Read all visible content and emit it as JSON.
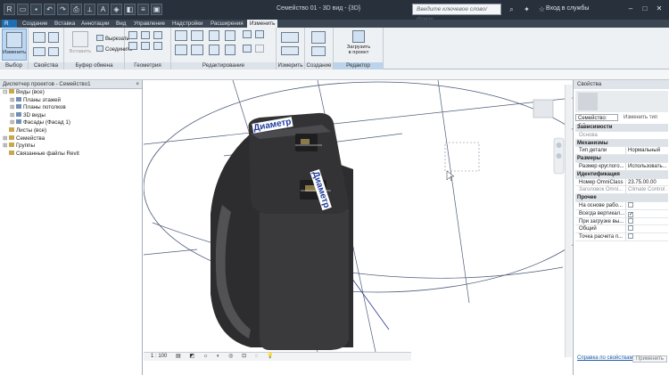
{
  "titlebar": {
    "title": "Семейство 01 - 3D вид - {3D}",
    "search_placeholder": "Введите ключевое слово/фразу",
    "login": "Вход в службы"
  },
  "tabs": [
    "Создание",
    "Вставка",
    "Аннотации",
    "Вид",
    "Управление",
    "Надстройки",
    "Расширения",
    "Изменить"
  ],
  "ribbon": {
    "groups": {
      "select": "Выбор",
      "properties": "Свойства",
      "clipboard": "Буфер обмена",
      "geometry": "Геометрия",
      "modify": "Редактирование",
      "measure": "Измерить",
      "create": "Создание",
      "family_editor": "Редактор семейств"
    },
    "modify_button": "Изменить",
    "paste_button": "Вставить",
    "cut_label": "Вырезать",
    "join_label": "Соединить",
    "load_line1": "Загрузить",
    "load_line2": "в проект"
  },
  "browser": {
    "title": "Диспетчер проектов - Семейство1",
    "close": "×",
    "items": [
      {
        "label": "Виды (все)",
        "level": 0,
        "toggle": "⊟"
      },
      {
        "label": "Планы этажей",
        "level": 1,
        "toggle": "⊞"
      },
      {
        "label": "Планы потолков",
        "level": 1,
        "toggle": "⊞"
      },
      {
        "label": "3D виды",
        "level": 1,
        "toggle": "⊞"
      },
      {
        "label": "Фасады (Фасад 1)",
        "level": 1,
        "toggle": "⊞"
      },
      {
        "label": "Листы (все)",
        "level": 0,
        "toggle": ""
      },
      {
        "label": "Семейства",
        "level": 0,
        "toggle": "⊞"
      },
      {
        "label": "Группы",
        "level": 0,
        "toggle": "⊞"
      },
      {
        "label": "Связанные файлы Revit",
        "level": 0,
        "toggle": ""
      }
    ]
  },
  "viewport": {
    "dim_label_1": "Диаметр",
    "dim_label_2": "Диаметр",
    "scale": "1 : 100"
  },
  "properties": {
    "title": "Свойства",
    "type_selector": "Семейство: Обо",
    "edit_type": "Изменить тип",
    "rows": [
      {
        "kind": "cat",
        "label": "Зависимости"
      },
      {
        "kind": "row",
        "key": "Основа",
        "value": "",
        "grey": true
      },
      {
        "kind": "cat",
        "label": "Механизмы"
      },
      {
        "kind": "row",
        "key": "Тип детали",
        "value": "Нормальный"
      },
      {
        "kind": "cat",
        "label": "Размеры"
      },
      {
        "kind": "row",
        "key": "Размер круглого...",
        "value": "Использовать..."
      },
      {
        "kind": "cat",
        "label": "Идентификация"
      },
      {
        "kind": "row",
        "key": "Номер OmniClass",
        "value": "23.75.00.00"
      },
      {
        "kind": "row",
        "key": "Заголовок Omni...",
        "value": "Climate Control ...",
        "grey": true
      },
      {
        "kind": "cat",
        "label": "Прочее"
      },
      {
        "kind": "check",
        "key": "На основе рабо...",
        "checked": false
      },
      {
        "kind": "check",
        "key": "Всегда вертикал...",
        "checked": true
      },
      {
        "kind": "check",
        "key": "При загрузке вы...",
        "checked": false
      },
      {
        "kind": "check",
        "key": "Общий",
        "checked": false
      },
      {
        "kind": "check",
        "key": "Точка расчета п...",
        "checked": false
      }
    ],
    "help_link": "Справка по свойствам",
    "apply": "Применить"
  }
}
